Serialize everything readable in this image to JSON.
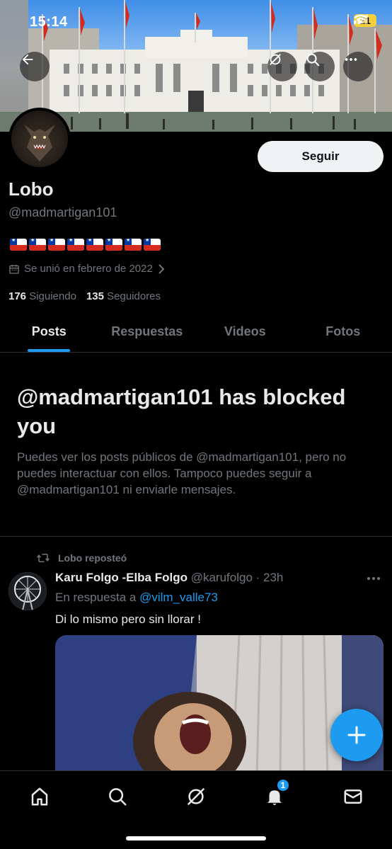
{
  "status_bar": {
    "time": "15:14",
    "battery": "21"
  },
  "banner": {
    "description": "government-palace-with-flags"
  },
  "profile": {
    "name": "Lobo",
    "handle": "@madmartigan101",
    "flag_count": 8,
    "joined": "Se unió en febrero de 2022",
    "following_count": "176",
    "following_label": "Siguiendo",
    "followers_count": "135",
    "followers_label": "Seguidores",
    "follow_button": "Seguir"
  },
  "tabs": [
    {
      "label": "Posts",
      "active": true
    },
    {
      "label": "Respuestas",
      "active": false
    },
    {
      "label": "Videos",
      "active": false
    },
    {
      "label": "Fotos",
      "active": false
    }
  ],
  "blocked": {
    "title": "@madmartigan101 has blocked you",
    "text": "Puedes ver los posts públicos de @madmartigan101, pero no puedes interactuar con ellos. Tampoco puedes seguir a @madmartigan101 ni enviarle mensajes."
  },
  "tweet": {
    "repost_label": "Lobo reposteó",
    "author_name": "Karu Folgo -Elba Folgo",
    "author_handle": "@karufolgo",
    "time": "23h",
    "meta": "@karufolgo · 23h",
    "reply_prefix": "En respuesta a",
    "reply_handle": "@vilm_valle73",
    "text": "Di lo mismo pero sin llorar !"
  },
  "nav": {
    "notification_badge": "1"
  },
  "colors": {
    "accent": "#1d9bf0",
    "background": "#000000",
    "secondary_text": "#71767b"
  }
}
